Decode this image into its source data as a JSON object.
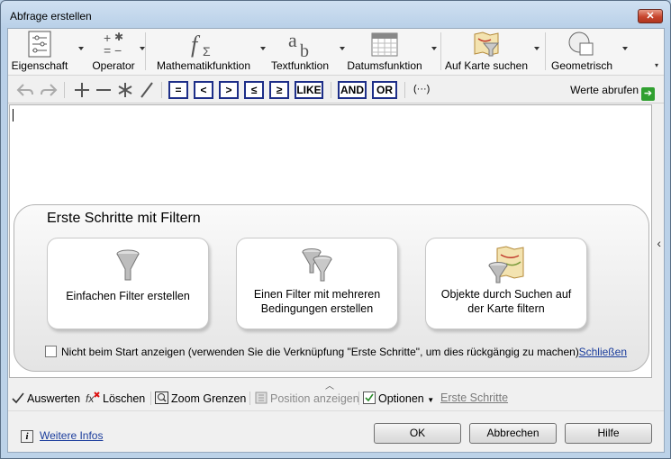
{
  "window": {
    "title": "Abfrage erstellen",
    "close_label": "✕"
  },
  "ribbon": {
    "items": [
      {
        "label": "Eigenschaft",
        "icon": "property-list-icon"
      },
      {
        "label": "Operator",
        "icon": "operator-icon"
      },
      {
        "label": "Mathematikfunktion",
        "icon": "math-function-icon"
      },
      {
        "label": "Textfunktion",
        "icon": "text-function-icon"
      },
      {
        "label": "Datumsfunktion",
        "icon": "calendar-icon"
      },
      {
        "label": "Auf Karte suchen",
        "icon": "map-filter-icon"
      },
      {
        "label": "Geometrisch",
        "icon": "geometry-icon"
      }
    ]
  },
  "toolbar": {
    "operators": [
      "=",
      "<",
      ">",
      "≤",
      "≥",
      "LIKE"
    ],
    "logic": [
      "AND",
      "OR"
    ],
    "ellipsis": "(···)",
    "fetch_values": "Werte abrufen"
  },
  "getting_started": {
    "title": "Erste Schritte mit Filtern",
    "cards": [
      {
        "label": "Einfachen Filter erstellen"
      },
      {
        "label": "Einen Filter mit mehreren Bedingungen erstellen"
      },
      {
        "label": "Objekte durch Suchen auf der Karte filtern"
      }
    ],
    "dont_show": "Nicht beim Start anzeigen (verwenden Sie die Verknüpfung \"Erste Schritte\", um dies rückgängig zu machen)",
    "close_link": "Schließen"
  },
  "actions": {
    "evaluate": "Auswerten",
    "delete": "Löschen",
    "zoom": "Zoom Grenzen",
    "position": "Position anzeigen",
    "options": "Optionen",
    "first_steps": "Erste Schritte"
  },
  "footer": {
    "more_info": "Weitere Infos",
    "ok": "OK",
    "cancel": "Abbrechen",
    "help": "Hilfe"
  }
}
